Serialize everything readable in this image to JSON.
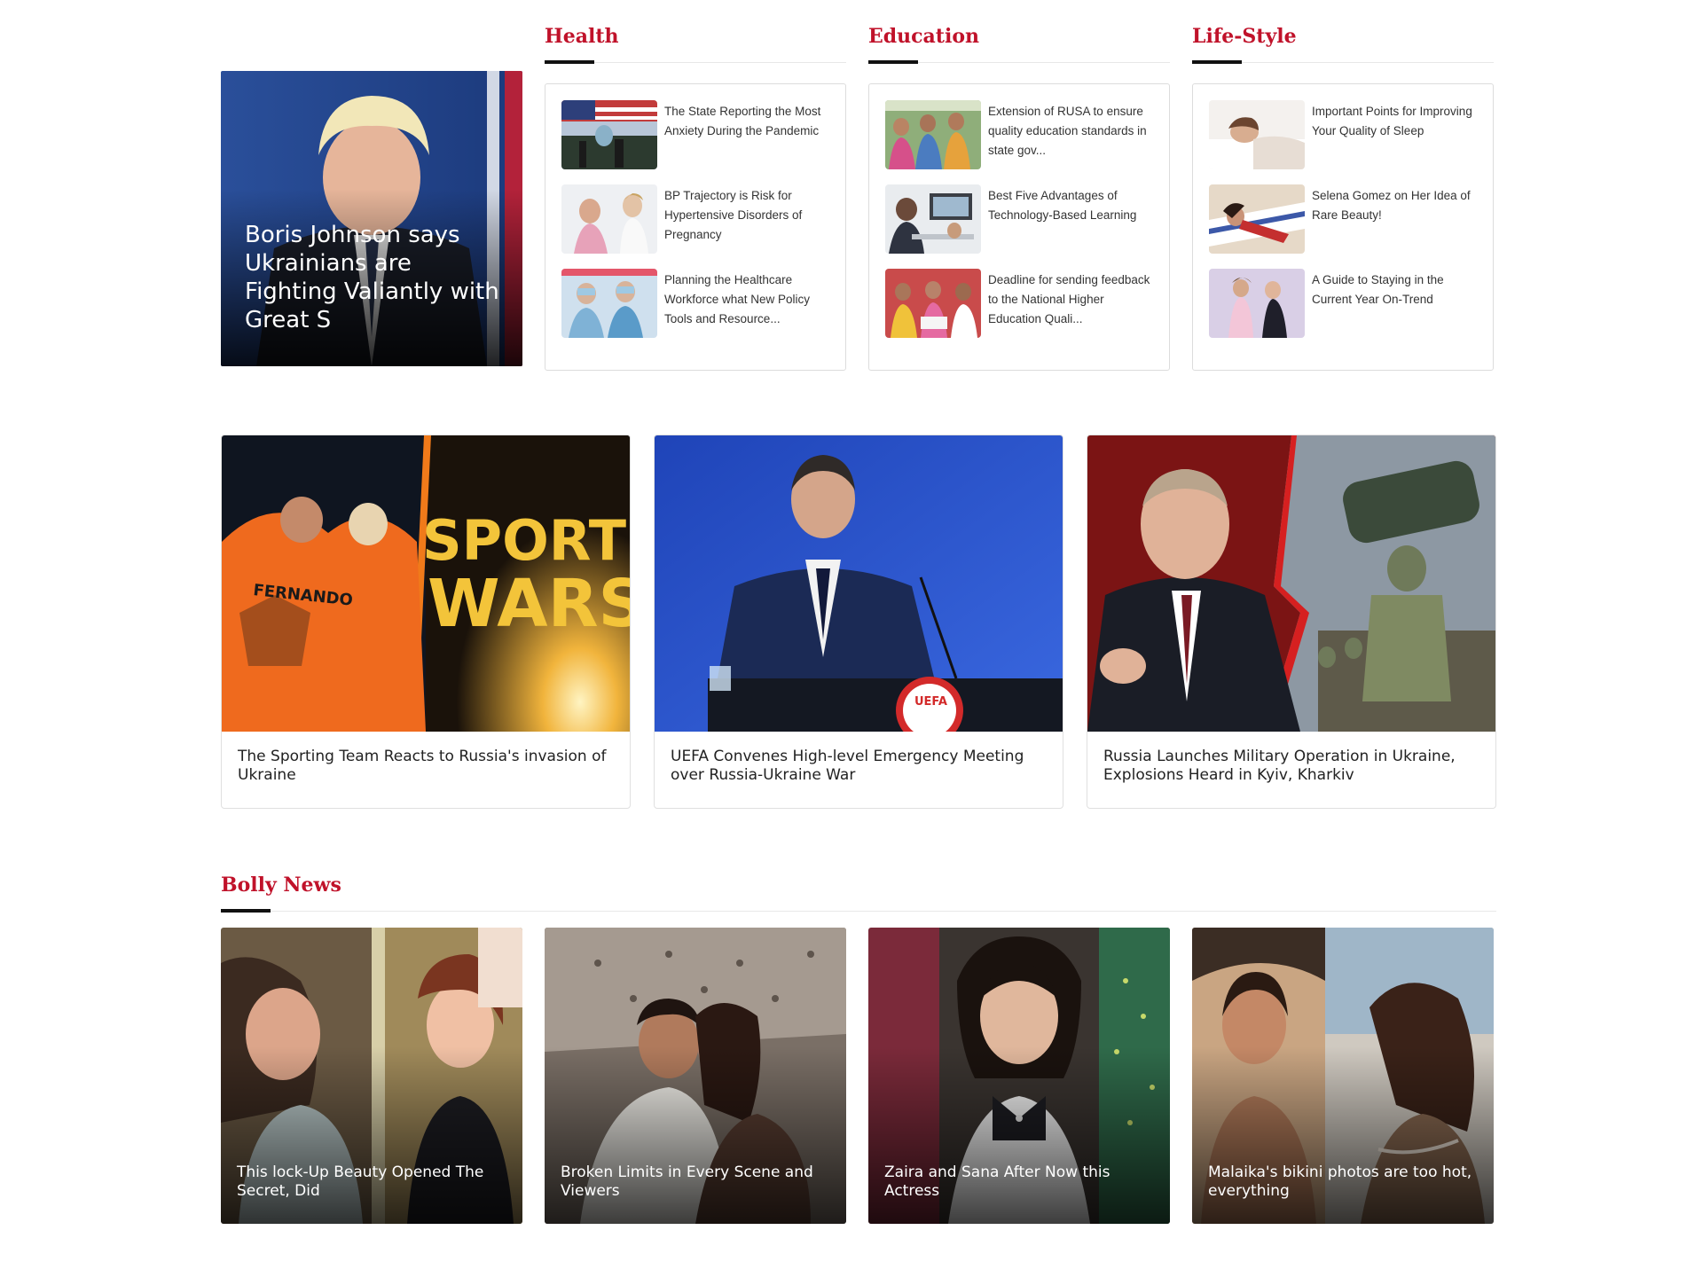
{
  "featured": {
    "title": "Boris Johnson says Ukrainians are Fighting Valiantly with Great S"
  },
  "sections": [
    {
      "name": "Health",
      "items": [
        {
          "title": "The State Reporting the Most Anxiety During the Pandemic"
        },
        {
          "title": "BP Trajectory is Risk for Hypertensive Disorders of Pregnancy"
        },
        {
          "title": "Planning the Healthcare Workforce what New Policy Tools and Resource..."
        }
      ]
    },
    {
      "name": "Education",
      "items": [
        {
          "title": "Extension of RUSA to ensure quality education standards in state gov..."
        },
        {
          "title": "Best Five Advantages of Technology-Based Learning"
        },
        {
          "title": "Deadline for sending feedback to the National Higher Education Quali..."
        }
      ]
    },
    {
      "name": "Life-Style",
      "items": [
        {
          "title": "Important Points for Improving Your Quality of Sleep"
        },
        {
          "title": "Selena Gomez on Her Idea of Rare Beauty!"
        },
        {
          "title": "A Guide to Staying in the Current Year On-Trend"
        }
      ]
    }
  ],
  "big_cards": [
    {
      "title": "The Sporting Team Reacts to Russia's invasion of Ukraine",
      "image_text": [
        "SPORTS",
        "WARS"
      ],
      "jersey_text": "FERNANDO"
    },
    {
      "title": "UEFA Convenes High-level Emergency Meeting over Russia-Ukraine War",
      "logo_text": "UEFA"
    },
    {
      "title": "Russia Launches Military Operation in Ukraine, Explosions Heard in Kyiv, Kharkiv"
    }
  ],
  "bolly": {
    "heading": "Bolly News",
    "items": [
      {
        "title": "This lock-Up Beauty Opened The Secret, Did"
      },
      {
        "title": "Broken Limits in Every Scene and Viewers"
      },
      {
        "title": "Zaira and Sana After Now this Actress"
      },
      {
        "title": "Malaika's bikini photos are too hot, everything"
      }
    ]
  },
  "colors": {
    "accent": "#c0122a",
    "rule": "#111111"
  }
}
